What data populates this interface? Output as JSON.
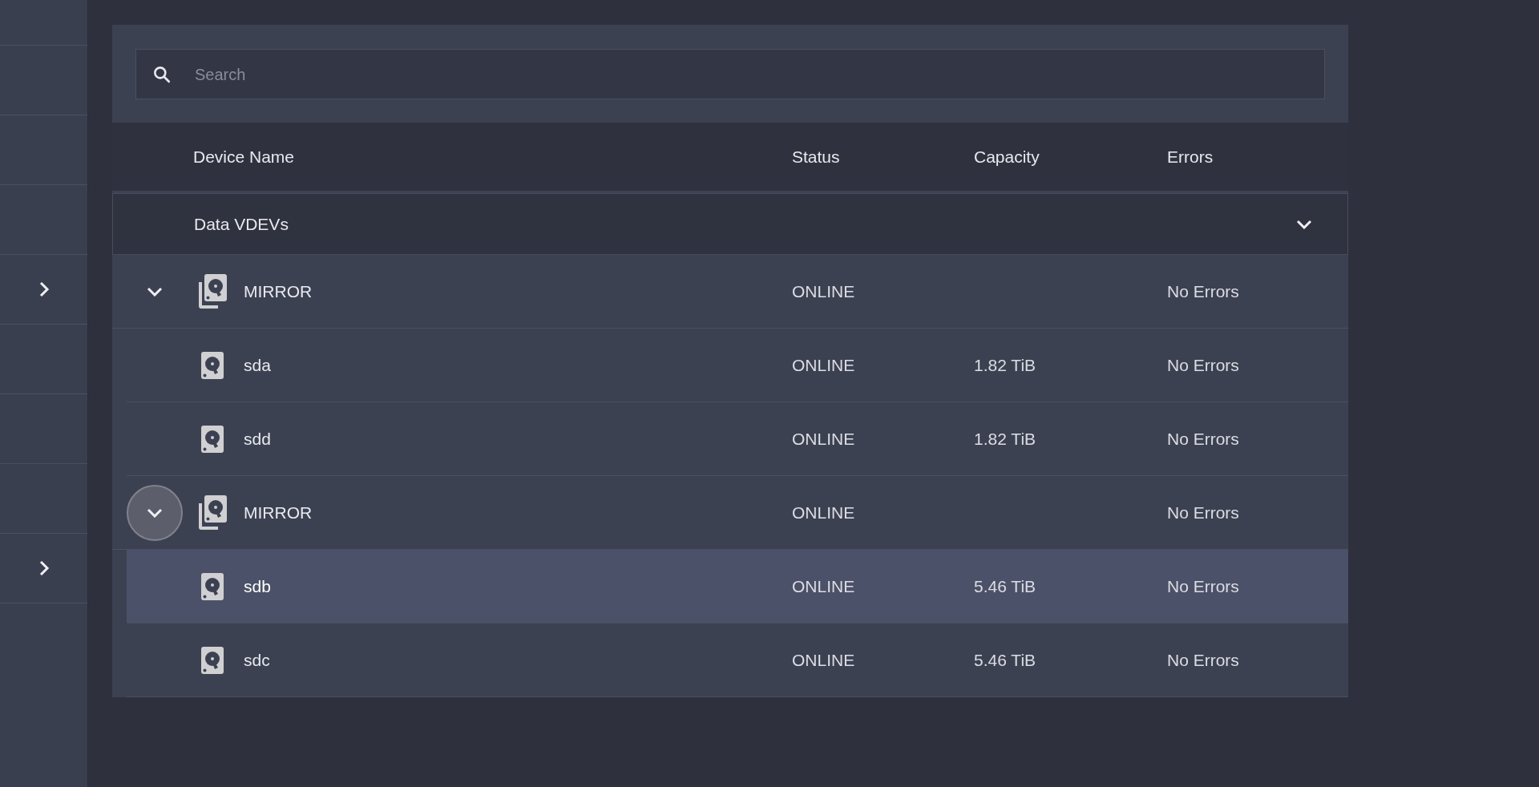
{
  "sidebar": {
    "items": [
      {
        "kind": "plain"
      },
      {
        "kind": "plain"
      },
      {
        "kind": "plain"
      },
      {
        "kind": "plain"
      },
      {
        "kind": "expandable"
      },
      {
        "kind": "plain"
      },
      {
        "kind": "plain"
      },
      {
        "kind": "plain"
      },
      {
        "kind": "expandable"
      }
    ]
  },
  "search": {
    "placeholder": "Search"
  },
  "table": {
    "columns": [
      "Device Name",
      "Status",
      "Capacity",
      "Errors"
    ],
    "groups": [
      {
        "label": "Data VDEVs",
        "expanded": true,
        "vdevs": [
          {
            "name": "MIRROR",
            "status": "ONLINE",
            "errors": "No Errors",
            "expanded": true,
            "focused": false,
            "selected": false,
            "children": [
              {
                "name": "sda",
                "status": "ONLINE",
                "capacity": "1.82 TiB",
                "errors": "No Errors",
                "selected": false
              },
              {
                "name": "sdd",
                "status": "ONLINE",
                "capacity": "1.82 TiB",
                "errors": "No Errors",
                "selected": false
              }
            ]
          },
          {
            "name": "MIRROR",
            "status": "ONLINE",
            "errors": "No Errors",
            "expanded": true,
            "focused": true,
            "selected": false,
            "children": [
              {
                "name": "sdb",
                "status": "ONLINE",
                "capacity": "5.46 TiB",
                "errors": "No Errors",
                "selected": true
              },
              {
                "name": "sdc",
                "status": "ONLINE",
                "capacity": "5.46 TiB",
                "errors": "No Errors",
                "selected": false
              }
            ]
          }
        ]
      }
    ]
  }
}
